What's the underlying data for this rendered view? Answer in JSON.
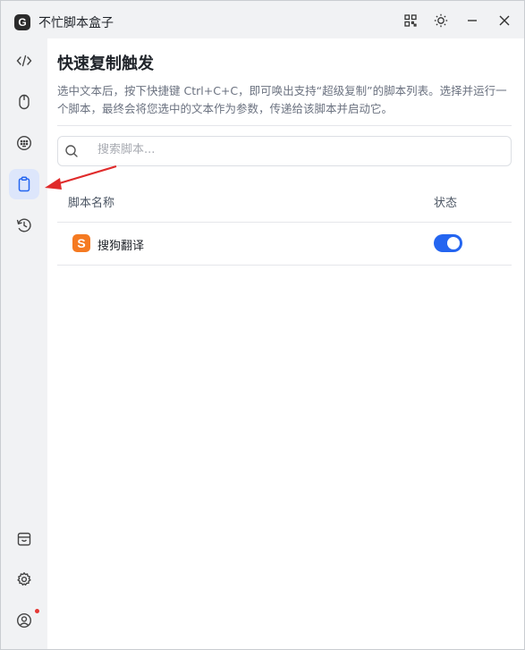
{
  "window": {
    "title": "不忙脚本盒子",
    "logo_letter": "G",
    "controls": [
      "grid-icon",
      "sun-icon",
      "minimize-icon",
      "close-icon"
    ]
  },
  "sidebar": {
    "items": [
      {
        "icon": "code-icon",
        "active": false
      },
      {
        "icon": "mouse-icon",
        "active": false
      },
      {
        "icon": "keyboard-icon",
        "active": false
      },
      {
        "icon": "clipboard-icon",
        "active": true
      },
      {
        "icon": "history-icon",
        "active": false
      }
    ],
    "bottom_items": [
      {
        "icon": "store-icon"
      },
      {
        "icon": "gear-icon"
      },
      {
        "icon": "user-icon",
        "notification": true
      }
    ]
  },
  "main": {
    "title": "快速复制触发",
    "description": "选中文本后，按下快捷键 Ctrl+C+C，即可唤出支持“超级复制”的脚本列表。选择并运行一个脚本，最终会将您选中的文本作为参数，传递给该脚本并启动它。",
    "search": {
      "placeholder": "搜索脚本...",
      "value": ""
    },
    "table": {
      "columns": [
        "脚本名称",
        "状态"
      ],
      "rows": [
        {
          "icon_letter": "S",
          "name": "搜狗翻译",
          "enabled": true
        }
      ]
    }
  },
  "colors": {
    "accent": "#2465f0",
    "sidebar_bg": "#f1f2f4",
    "active_item_bg": "#dde6fb",
    "row_icon": "#f57a22",
    "annotation_arrow": "#e02b2b"
  }
}
